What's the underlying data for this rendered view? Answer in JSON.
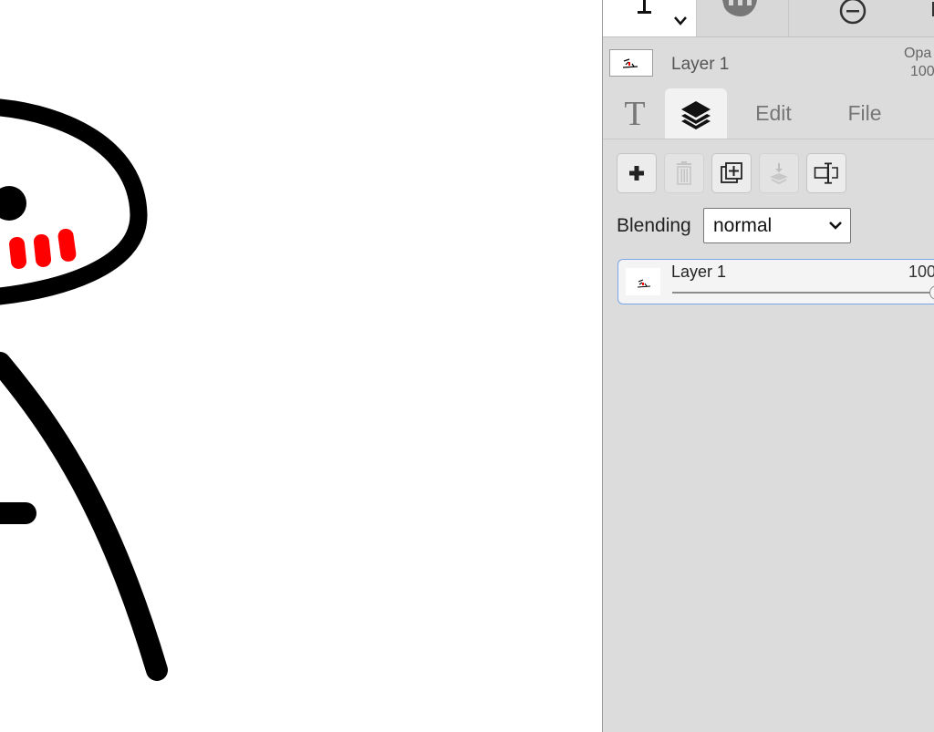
{
  "app": {
    "accent_color": "#7aa6e8",
    "panel_color": "#dcdcdc"
  },
  "toolbar": {
    "tools": [
      {
        "name": "text-tool",
        "icon": "text-cursor-icon",
        "active": true
      },
      {
        "name": "hand-tool",
        "icon": "hand-icon",
        "active": false
      },
      {
        "name": "zoom-out-tool",
        "icon": "minus-circle-icon",
        "active": false
      }
    ]
  },
  "active_layer": {
    "name": "Layer 1",
    "opacity_label": "Opa",
    "opacity_value": "100"
  },
  "tabs": [
    {
      "id": "text",
      "icon": "text-icon",
      "label": "T"
    },
    {
      "id": "layers",
      "icon": "layers-icon",
      "label": ""
    },
    {
      "id": "edit",
      "label": "Edit"
    },
    {
      "id": "file",
      "label": "File"
    }
  ],
  "layer_actions": [
    {
      "id": "add",
      "icon": "plus-icon",
      "enabled": true
    },
    {
      "id": "delete",
      "icon": "trash-icon",
      "enabled": false
    },
    {
      "id": "duplicate",
      "icon": "duplicate-icon",
      "enabled": true
    },
    {
      "id": "merge-down",
      "icon": "merge-down-icon",
      "enabled": false
    },
    {
      "id": "rename",
      "icon": "rename-icon",
      "enabled": true
    }
  ],
  "blending": {
    "label": "Blending",
    "value": "normal"
  },
  "layers": [
    {
      "name": "Layer 1",
      "opacity": "100",
      "opacity_fraction": 1.0,
      "selected": true
    }
  ]
}
